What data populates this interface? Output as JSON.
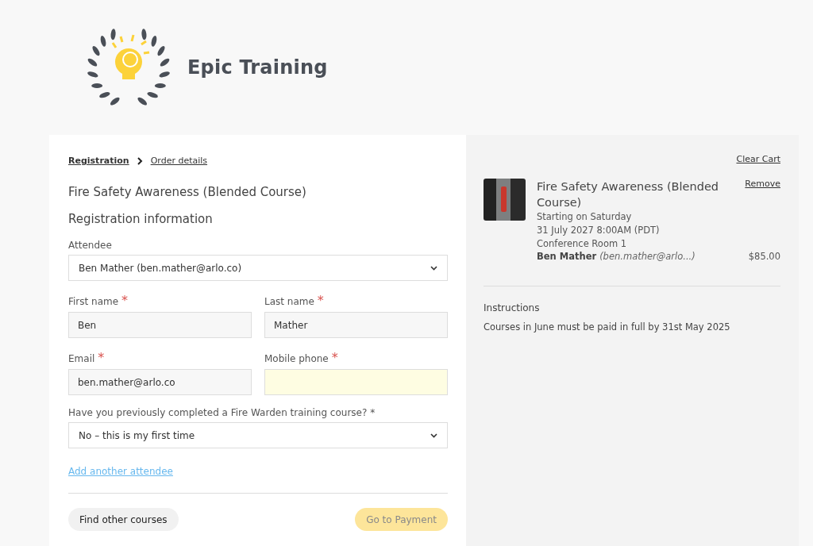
{
  "logo": {
    "name": "Epic Training"
  },
  "breadcrumb": [
    {
      "label": "Registration",
      "selected": true
    },
    {
      "label": "Order details",
      "selected": false
    }
  ],
  "course_title": "Fire Safety Awareness (Blended Course)",
  "section_title": "Registration information",
  "fields": [
    {
      "kind": "select",
      "label": "Attendee",
      "value": "Ben Mather (ben.mather@arlo.co)"
    },
    {
      "kind": "text",
      "label": "First name",
      "required_mark": "*",
      "value": "Ben",
      "highlighted": false
    },
    {
      "kind": "text",
      "label": "Last name",
      "required_mark": "*",
      "value": "Mather",
      "highlighted": false
    },
    {
      "kind": "text",
      "label": "Email",
      "required_mark": "*",
      "value": "ben.mather@arlo.co",
      "highlighted": false
    },
    {
      "kind": "text",
      "label": "Mobile phone",
      "required_mark": "*",
      "highlighted": true
    },
    {
      "kind": "select",
      "label": "Have you previously completed a Fire Warden training course? *",
      "value": "No – this is my first time"
    }
  ],
  "add_attendee_link": "Add another attendee",
  "buttons": [
    {
      "label": "Find other courses",
      "kind": "secondary",
      "disabled": false
    },
    {
      "label": "Go to Payment",
      "kind": "primary",
      "disabled": true
    }
  ],
  "cart": {
    "clear_link": "Clear Cart",
    "items": [
      {
        "title": "Fire Safety Awareness (Blended Course)",
        "remove_link": "Remove",
        "details": [
          "Starting on Saturday",
          "31 July 2027 8:00AM (PDT)",
          "Conference Room 1"
        ],
        "attendee_name": "Ben Mather",
        "attendee_email": "(ben.mather@arlo...)",
        "price": "$85.00"
      }
    ],
    "instructions_title": "Instructions",
    "instructions_text": "Courses in June must be paid in full by 31st May 2025"
  }
}
